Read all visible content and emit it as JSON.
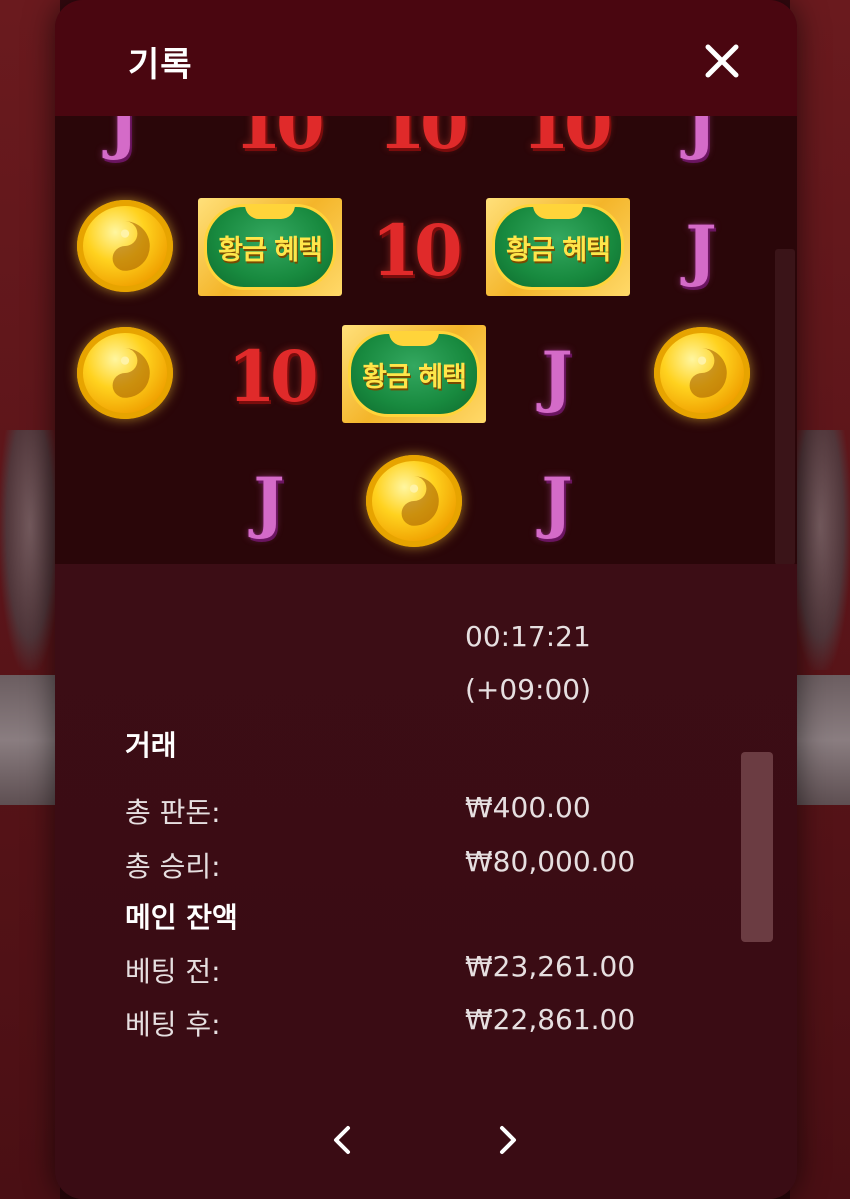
{
  "modal": {
    "title": "기록"
  },
  "reels": {
    "bonus_label": "황금 혜택",
    "symbols": [
      "J",
      "10"
    ]
  },
  "details": {
    "time": "00:17:21",
    "timezone": "(+09:00)",
    "transaction_heading": "거래",
    "total_bet_label": "총 판돈:",
    "total_bet_value": "₩400.00",
    "total_win_label": "총 승리:",
    "total_win_value": "₩80,000.00",
    "main_balance_heading": "메인 잔액",
    "before_bet_label": "베팅 전:",
    "before_bet_value": "₩23,261.00",
    "after_bet_label": "베팅 후:",
    "after_bet_value": "₩22,861.00"
  },
  "colors": {
    "header_bg": "#4a0610",
    "panel_bg": "#3c0c14",
    "reel_bg": "#2a0609",
    "j_symbol": "#d46bc8",
    "ten_symbol": "#e02a2a",
    "coin_gold": "#ffd21f",
    "bonus_green": "#188a3f"
  },
  "icons": {
    "close": "close-icon",
    "prev": "chevron-left-icon",
    "next": "chevron-right-icon",
    "coin": "yin-yang-coin-icon"
  }
}
